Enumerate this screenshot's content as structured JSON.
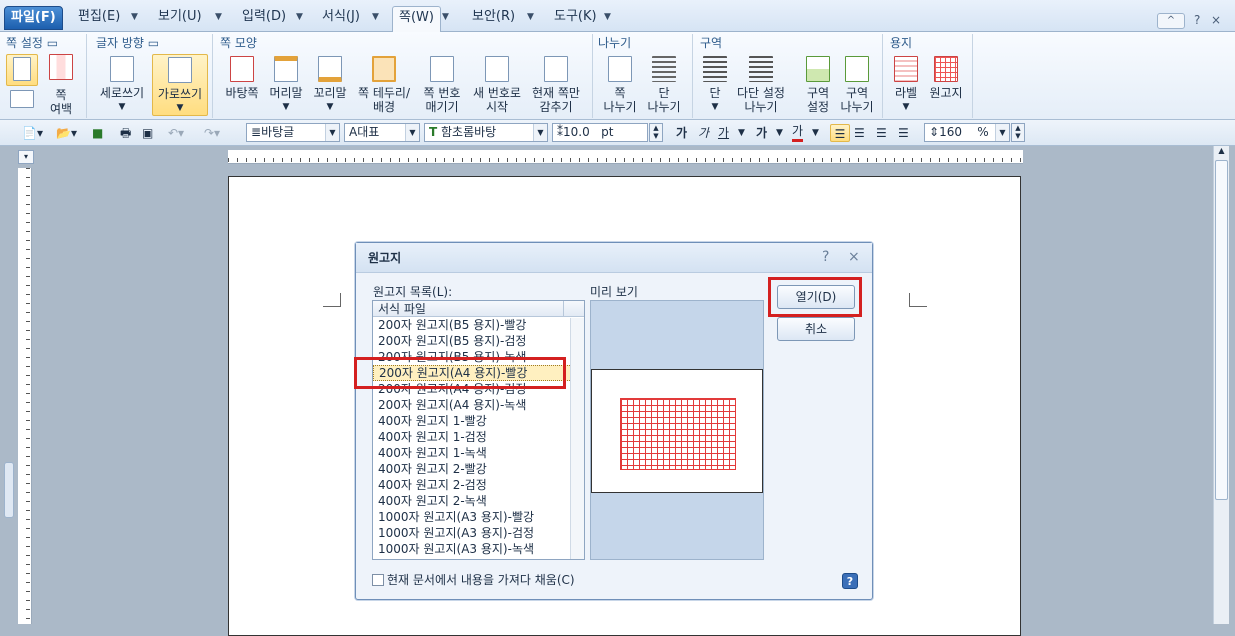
{
  "menubar": {
    "file": "파일(F)",
    "items": [
      "편집(E)",
      "보기(U)",
      "입력(D)",
      "서식(J)",
      "쪽(W)",
      "보안(R)",
      "도구(K)"
    ],
    "help": "?",
    "close": "×",
    "collapse": "^"
  },
  "ribbon": {
    "groups": [
      {
        "title": "쪽 설정"
      },
      {
        "title": "글자 방향"
      },
      {
        "title": "쪽 모양"
      },
      {
        "title": "나누기"
      },
      {
        "title": "구역"
      },
      {
        "title": "용지"
      }
    ],
    "buttons": {
      "margin": "쪽\n여백",
      "vertical": "세로쓰기",
      "horizontal": "가로쓰기",
      "bg": "바탕쪽",
      "header": "머리말",
      "footer": "꼬리말",
      "border": "쪽 테두리/\n배경",
      "hide_num": "쪽 번호\n매기기",
      "new_num": "새 번호로\n시작",
      "hide": "현재 쪽만\n감추기",
      "page_break": "쪽\n나누기",
      "col_break": "단\n나누기",
      "col": "단",
      "multi_col": "다단 설정\n나누기",
      "sec_set": "구역\n설정",
      "sec_break": "구역\n나누기",
      "label": "라벨",
      "wongoji": "원고지"
    }
  },
  "toolbar": {
    "style": "바탕글",
    "lang": "대표",
    "font": "함초롬바탕",
    "size": "10.0",
    "unit": "pt",
    "bold": "가",
    "italic": "가",
    "underline": "가",
    "strike": "가",
    "color": "가",
    "zoom": "160",
    "zoom_unit": "%"
  },
  "dialog": {
    "title": "원고지",
    "help": "?",
    "close": "×",
    "list_label": "원고지 목록(L):",
    "list_header": "서식 파일",
    "items": [
      "200자 원고지(B5 용지)-빨강",
      "200자 원고지(B5 용지)-검정",
      "200자 원고지(B5 용지)-녹색",
      "200자 원고지(A4 용지)-빨강",
      "200자 원고지(A4 용지)-검정",
      "200자 원고지(A4 용지)-녹색",
      "400자 원고지 1-빨강",
      "400자 원고지 1-검정",
      "400자 원고지 1-녹색",
      "400자 원고지 2-빨강",
      "400자 원고지 2-검정",
      "400자 원고지 2-녹색",
      "1000자 원고지(A3 용지)-빨강",
      "1000자 원고지(A3 용지)-검정",
      "1000자 원고지(A3 용지)-녹색"
    ],
    "selected_index": 3,
    "preview_label": "미리 보기",
    "open_btn": "열기(D)",
    "cancel_btn": "취소",
    "checkbox": "현재 문서에서 내용을 가져다 채움(C)",
    "checked": false
  }
}
